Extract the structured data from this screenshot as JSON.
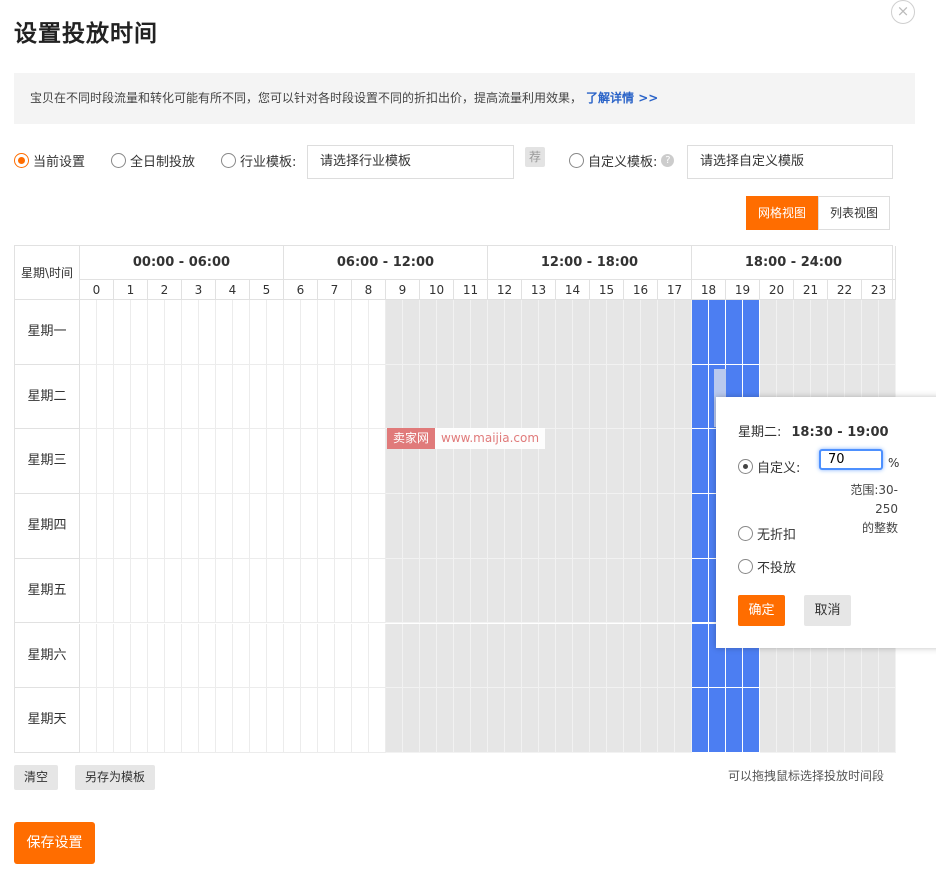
{
  "title": "设置投放时间",
  "notice": {
    "text": "宝贝在不同时段流量和转化可能有所不同，您可以针对各时段设置不同的折扣出价，提高流量利用效果，",
    "link": "了解详情 >>"
  },
  "options": {
    "current": "当前设置",
    "all_day": "全日制投放",
    "industry": "行业模板:",
    "industry_placeholder": "请选择行业模板",
    "rec_icon": "荐",
    "custom": "自定义模板:",
    "custom_placeholder": "请选择自定义模版",
    "selected": "current"
  },
  "view": {
    "grid": "网格视图",
    "list": "列表视图",
    "active": "grid"
  },
  "grid": {
    "corner": "星期\\时间",
    "groups": [
      "00:00 - 06:00",
      "06:00 - 12:00",
      "12:00 - 18:00",
      "18:00 - 24:00"
    ],
    "hours": [
      "0",
      "1",
      "2",
      "3",
      "4",
      "5",
      "6",
      "7",
      "8",
      "9",
      "10",
      "11",
      "12",
      "13",
      "14",
      "15",
      "16",
      "17",
      "18",
      "19",
      "20",
      "21",
      "22",
      "23"
    ],
    "days": [
      "星期一",
      "星期二",
      "星期三",
      "星期四",
      "星期五",
      "星期六",
      "星期天"
    ],
    "state_by_hour": [
      "white",
      "white",
      "white",
      "white",
      "white",
      "white",
      "white",
      "white",
      "white",
      "gray",
      "gray",
      "gray",
      "gray",
      "gray",
      "gray",
      "gray",
      "gray",
      "gray",
      "blue",
      "blue",
      "gray",
      "gray",
      "gray",
      "gray"
    ],
    "selected_slot": {
      "day": "星期二",
      "hour": 18,
      "half": "second"
    }
  },
  "buttons": {
    "clear": "清空",
    "save_template": "另存为模板",
    "save": "保存设置"
  },
  "drag_tip": "可以拖拽鼠标选择投放时间段",
  "popup": {
    "day": "星期二:",
    "range": "18:30 - 19:00",
    "custom_label": "自定义:",
    "value": "70",
    "unit": "%",
    "hint_line1": "范围:30-250",
    "hint_line2": "的整数",
    "no_discount": "无折扣",
    "no_delivery": "不投放",
    "ok": "确定",
    "cancel": "取消"
  },
  "watermark": {
    "brand": "卖家网",
    "url": "www.maijia.com"
  },
  "colors": {
    "accent": "#ff6d00",
    "cell_blue": "#4c7ef2",
    "cell_gray": "#e6e6e6",
    "link": "#2a63c8"
  }
}
